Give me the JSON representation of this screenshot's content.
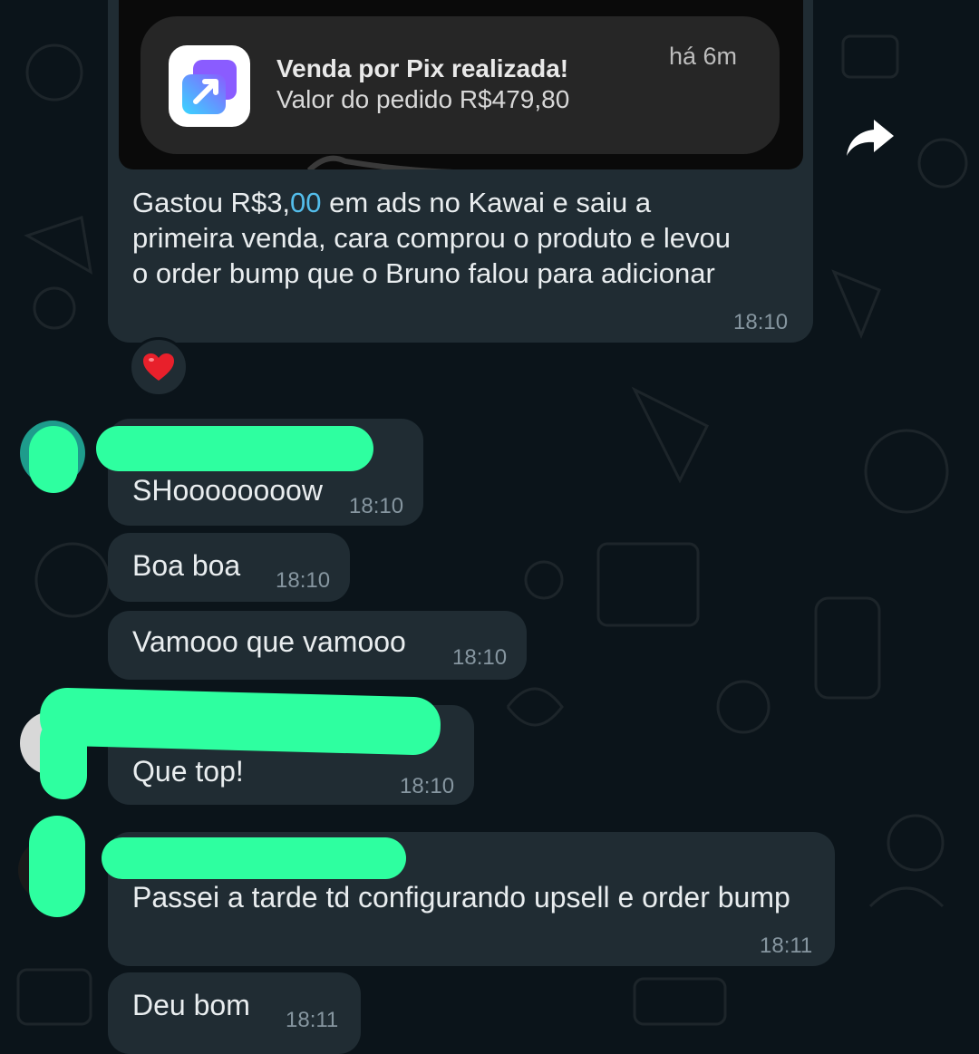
{
  "colors": {
    "background": "#0b141a",
    "bubble": "#202c33",
    "text": "#e9edef",
    "timestamp": "#8696a0",
    "link": "#53bdeb",
    "redaction": "#2effa0"
  },
  "notification": {
    "app_icon": "payment-app-icon",
    "title": "Venda por Pix realizada!",
    "body": "Valor do pedido R$479,80",
    "time_ago": "há 6m"
  },
  "messages": [
    {
      "caption_line1_a": "Gastou R$3,",
      "caption_line1_link": "00",
      "caption_line1_b": " em ads no Kawai e saiu a",
      "caption_line2": "primeira venda, cara comprou o produto e levou",
      "caption_line3": "o order bump que o Bruno falou para adicionar",
      "time": "18:10",
      "reaction": "heart-emoji"
    },
    {
      "text": "SHoooooooow",
      "time": "18:10"
    },
    {
      "text": "Boa boa",
      "time": "18:10"
    },
    {
      "text": "Vamooo que vamooo",
      "time": "18:10"
    },
    {
      "text": "Que top!",
      "time": "18:10"
    },
    {
      "text": "Passei a tarde td configurando upsell e order bump",
      "time": "18:11"
    },
    {
      "text": "Deu bom",
      "time": "18:11"
    }
  ],
  "icons": [
    "forward-icon",
    "heart-icon",
    "avatar"
  ]
}
